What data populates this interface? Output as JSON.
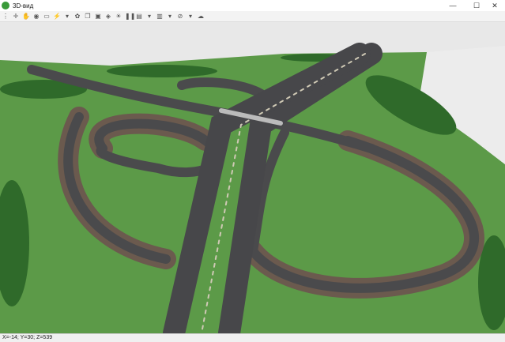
{
  "window": {
    "title": "3D-вид",
    "minimize": "—",
    "maximize": "☐",
    "close": "✕"
  },
  "toolbar": {
    "items": [
      {
        "name": "grip",
        "glyph": "⋮"
      },
      {
        "name": "pan-icon",
        "glyph": "✛"
      },
      {
        "name": "hand-icon",
        "glyph": "✋"
      },
      {
        "name": "eye-icon",
        "glyph": "◉"
      },
      {
        "name": "car-icon",
        "glyph": "▭"
      },
      {
        "name": "lightning-icon",
        "glyph": "⚡"
      },
      {
        "name": "dropdown",
        "glyph": "▾"
      },
      {
        "name": "palette-icon",
        "glyph": "✿"
      },
      {
        "name": "copy-icon",
        "glyph": "❐"
      },
      {
        "name": "image-icon",
        "glyph": "▣"
      },
      {
        "name": "layers-icon",
        "glyph": "◈"
      },
      {
        "name": "light-icon",
        "glyph": "☀"
      },
      {
        "name": "pause-icon",
        "glyph": "❚❚"
      },
      {
        "name": "camera-icon",
        "glyph": "▤"
      },
      {
        "name": "dropdown",
        "glyph": "▾"
      },
      {
        "name": "screen-icon",
        "glyph": "▥"
      },
      {
        "name": "dropdown",
        "glyph": "▾"
      },
      {
        "name": "compass-icon",
        "glyph": "⊘"
      },
      {
        "name": "dropdown",
        "glyph": "▾"
      },
      {
        "name": "folder-icon",
        "glyph": "☁"
      }
    ]
  },
  "status": {
    "coords": "X=-14; Y=30; Z=539"
  },
  "colors": {
    "sky": "#e6e6e6",
    "grass": "#5c9a48",
    "road": "#4a4a4c",
    "embankment": "#6b5a4e",
    "trees": "#2f6a2a"
  }
}
